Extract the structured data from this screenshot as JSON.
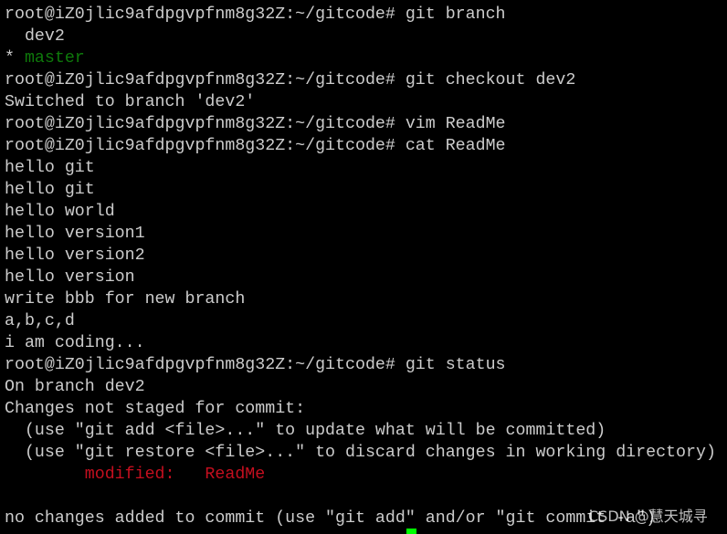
{
  "terminal": {
    "colors": {
      "text": "#cccccc",
      "branch_current": "#0e7a0b",
      "modified": "#c50f1f",
      "cursor": "#00ff00"
    },
    "lines": [
      [
        {
          "t": "root@iZ0jlic9afdpgvpfnm8g32Z:~/gitcode# git branch"
        }
      ],
      [
        {
          "t": "  dev2"
        }
      ],
      [
        {
          "t": "* "
        },
        {
          "t": "master",
          "c": "green"
        }
      ],
      [
        {
          "t": "root@iZ0jlic9afdpgvpfnm8g32Z:~/gitcode# git checkout dev2"
        }
      ],
      [
        {
          "t": "Switched to branch 'dev2'"
        }
      ],
      [
        {
          "t": "root@iZ0jlic9afdpgvpfnm8g32Z:~/gitcode# vim ReadMe"
        }
      ],
      [
        {
          "t": "root@iZ0jlic9afdpgvpfnm8g32Z:~/gitcode# cat ReadMe"
        }
      ],
      [
        {
          "t": "hello git"
        }
      ],
      [
        {
          "t": "hello git"
        }
      ],
      [
        {
          "t": "hello world"
        }
      ],
      [
        {
          "t": "hello version1"
        }
      ],
      [
        {
          "t": "hello version2"
        }
      ],
      [
        {
          "t": "hello version"
        }
      ],
      [
        {
          "t": "write bbb for new branch"
        }
      ],
      [
        {
          "t": "a,b,c,d"
        }
      ],
      [
        {
          "t": "i am coding..."
        }
      ],
      [
        {
          "t": "root@iZ0jlic9afdpgvpfnm8g32Z:~/gitcode# git status"
        }
      ],
      [
        {
          "t": "On branch dev2"
        }
      ],
      [
        {
          "t": "Changes not staged for commit:"
        }
      ],
      [
        {
          "t": "  (use \"git add <file>...\" to update what will be committed)"
        }
      ],
      [
        {
          "t": "  (use \"git restore <file>...\" to discard changes in working directory)"
        }
      ],
      [
        {
          "t": "        "
        },
        {
          "t": "modified:   ReadMe",
          "c": "red"
        }
      ],
      [
        {
          "t": ""
        }
      ],
      [
        {
          "t": "no changes added to commit (use \"git add\" and/or \"git commit -a\")"
        }
      ]
    ]
  },
  "watermark": "CSDN @慧天城寻"
}
